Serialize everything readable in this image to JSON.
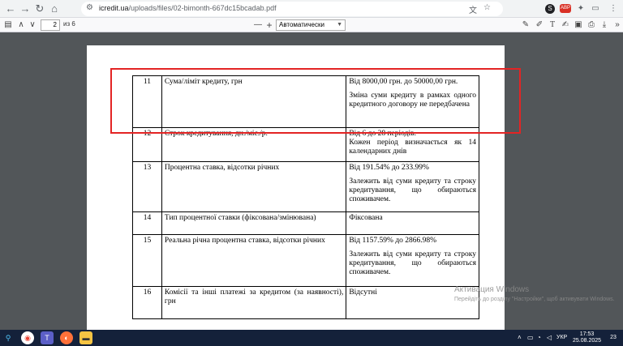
{
  "browser": {
    "url_host": "icredit.ua",
    "url_path": "/uploads/files/02-bimonth-667dc15bcadab.pdf"
  },
  "pdf_toolbar": {
    "page_current": "2",
    "page_total": "из 6",
    "zoom": "Автоматически",
    "zoom_minus": "—",
    "zoom_plus": "+"
  },
  "table": {
    "rows": [
      {
        "num": "11",
        "label": "Сума/ліміт кредиту, грн",
        "values": [
          "Від 8000,00 грн. до 50000,00 грн.",
          "Зміна суми кредиту в рамках одного кредитного договору не передбачена"
        ]
      },
      {
        "num": "12",
        "label": "Строк кредитування, дн./міс./р.",
        "values": [
          "Від 6 до 28 періодів.",
          "Кожен період визначається як 14 календарних днів"
        ]
      },
      {
        "num": "13",
        "label": "Процентна ставка, відсотки річних",
        "values": [
          "Від 191.54% до 233.99%",
          "Залежить від суми кредиту та строку кредитування, що обираються споживачем."
        ]
      },
      {
        "num": "14",
        "label": "Тип процентної ставки (фіксована/змінювана)",
        "values": [
          "Фіксована"
        ]
      },
      {
        "num": "15",
        "label": "Реальна річна процентна ставка, відсотки річних",
        "values": [
          "Від 1157.59% до 2866.98%",
          "Залежить від суми кредиту та строку кредитування, що обираються споживачем."
        ]
      },
      {
        "num": "16",
        "label": "Комісії та інші платежі за кредитом (за наявності), грн",
        "values": [
          "Відсутні"
        ]
      }
    ]
  },
  "watermark": {
    "title": "Активация Windows",
    "subtitle": "Перейдіть до розділу \"Настройки\", щоб активувати Windows."
  },
  "taskbar": {
    "lang": "УКР",
    "time": "17:53",
    "date": "25.08.2025",
    "notif_count": "23"
  }
}
